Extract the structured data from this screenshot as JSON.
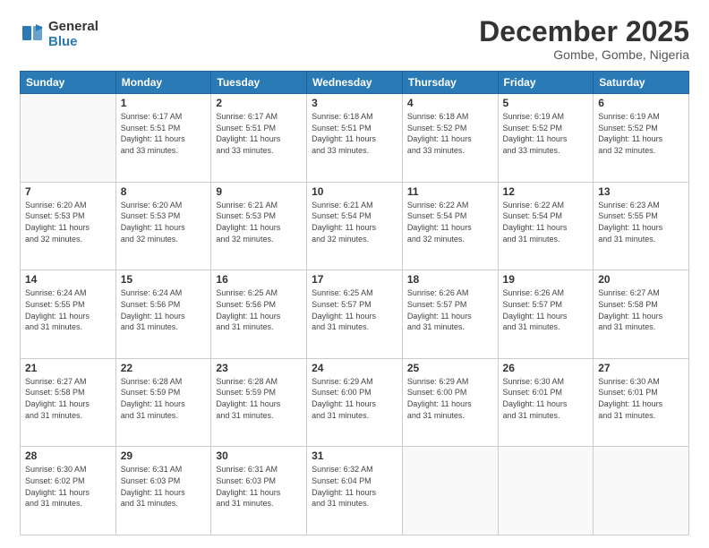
{
  "logo": {
    "general": "General",
    "blue": "Blue"
  },
  "title": "December 2025",
  "subtitle": "Gombe, Gombe, Nigeria",
  "days_header": [
    "Sunday",
    "Monday",
    "Tuesday",
    "Wednesday",
    "Thursday",
    "Friday",
    "Saturday"
  ],
  "weeks": [
    [
      {
        "day": "",
        "info": ""
      },
      {
        "day": "1",
        "info": "Sunrise: 6:17 AM\nSunset: 5:51 PM\nDaylight: 11 hours\nand 33 minutes."
      },
      {
        "day": "2",
        "info": "Sunrise: 6:17 AM\nSunset: 5:51 PM\nDaylight: 11 hours\nand 33 minutes."
      },
      {
        "day": "3",
        "info": "Sunrise: 6:18 AM\nSunset: 5:51 PM\nDaylight: 11 hours\nand 33 minutes."
      },
      {
        "day": "4",
        "info": "Sunrise: 6:18 AM\nSunset: 5:52 PM\nDaylight: 11 hours\nand 33 minutes."
      },
      {
        "day": "5",
        "info": "Sunrise: 6:19 AM\nSunset: 5:52 PM\nDaylight: 11 hours\nand 33 minutes."
      },
      {
        "day": "6",
        "info": "Sunrise: 6:19 AM\nSunset: 5:52 PM\nDaylight: 11 hours\nand 32 minutes."
      }
    ],
    [
      {
        "day": "7",
        "info": "Sunrise: 6:20 AM\nSunset: 5:53 PM\nDaylight: 11 hours\nand 32 minutes."
      },
      {
        "day": "8",
        "info": "Sunrise: 6:20 AM\nSunset: 5:53 PM\nDaylight: 11 hours\nand 32 minutes."
      },
      {
        "day": "9",
        "info": "Sunrise: 6:21 AM\nSunset: 5:53 PM\nDaylight: 11 hours\nand 32 minutes."
      },
      {
        "day": "10",
        "info": "Sunrise: 6:21 AM\nSunset: 5:54 PM\nDaylight: 11 hours\nand 32 minutes."
      },
      {
        "day": "11",
        "info": "Sunrise: 6:22 AM\nSunset: 5:54 PM\nDaylight: 11 hours\nand 32 minutes."
      },
      {
        "day": "12",
        "info": "Sunrise: 6:22 AM\nSunset: 5:54 PM\nDaylight: 11 hours\nand 31 minutes."
      },
      {
        "day": "13",
        "info": "Sunrise: 6:23 AM\nSunset: 5:55 PM\nDaylight: 11 hours\nand 31 minutes."
      }
    ],
    [
      {
        "day": "14",
        "info": "Sunrise: 6:24 AM\nSunset: 5:55 PM\nDaylight: 11 hours\nand 31 minutes."
      },
      {
        "day": "15",
        "info": "Sunrise: 6:24 AM\nSunset: 5:56 PM\nDaylight: 11 hours\nand 31 minutes."
      },
      {
        "day": "16",
        "info": "Sunrise: 6:25 AM\nSunset: 5:56 PM\nDaylight: 11 hours\nand 31 minutes."
      },
      {
        "day": "17",
        "info": "Sunrise: 6:25 AM\nSunset: 5:57 PM\nDaylight: 11 hours\nand 31 minutes."
      },
      {
        "day": "18",
        "info": "Sunrise: 6:26 AM\nSunset: 5:57 PM\nDaylight: 11 hours\nand 31 minutes."
      },
      {
        "day": "19",
        "info": "Sunrise: 6:26 AM\nSunset: 5:57 PM\nDaylight: 11 hours\nand 31 minutes."
      },
      {
        "day": "20",
        "info": "Sunrise: 6:27 AM\nSunset: 5:58 PM\nDaylight: 11 hours\nand 31 minutes."
      }
    ],
    [
      {
        "day": "21",
        "info": "Sunrise: 6:27 AM\nSunset: 5:58 PM\nDaylight: 11 hours\nand 31 minutes."
      },
      {
        "day": "22",
        "info": "Sunrise: 6:28 AM\nSunset: 5:59 PM\nDaylight: 11 hours\nand 31 minutes."
      },
      {
        "day": "23",
        "info": "Sunrise: 6:28 AM\nSunset: 5:59 PM\nDaylight: 11 hours\nand 31 minutes."
      },
      {
        "day": "24",
        "info": "Sunrise: 6:29 AM\nSunset: 6:00 PM\nDaylight: 11 hours\nand 31 minutes."
      },
      {
        "day": "25",
        "info": "Sunrise: 6:29 AM\nSunset: 6:00 PM\nDaylight: 11 hours\nand 31 minutes."
      },
      {
        "day": "26",
        "info": "Sunrise: 6:30 AM\nSunset: 6:01 PM\nDaylight: 11 hours\nand 31 minutes."
      },
      {
        "day": "27",
        "info": "Sunrise: 6:30 AM\nSunset: 6:01 PM\nDaylight: 11 hours\nand 31 minutes."
      }
    ],
    [
      {
        "day": "28",
        "info": "Sunrise: 6:30 AM\nSunset: 6:02 PM\nDaylight: 11 hours\nand 31 minutes."
      },
      {
        "day": "29",
        "info": "Sunrise: 6:31 AM\nSunset: 6:03 PM\nDaylight: 11 hours\nand 31 minutes."
      },
      {
        "day": "30",
        "info": "Sunrise: 6:31 AM\nSunset: 6:03 PM\nDaylight: 11 hours\nand 31 minutes."
      },
      {
        "day": "31",
        "info": "Sunrise: 6:32 AM\nSunset: 6:04 PM\nDaylight: 11 hours\nand 31 minutes."
      },
      {
        "day": "",
        "info": ""
      },
      {
        "day": "",
        "info": ""
      },
      {
        "day": "",
        "info": ""
      }
    ]
  ]
}
